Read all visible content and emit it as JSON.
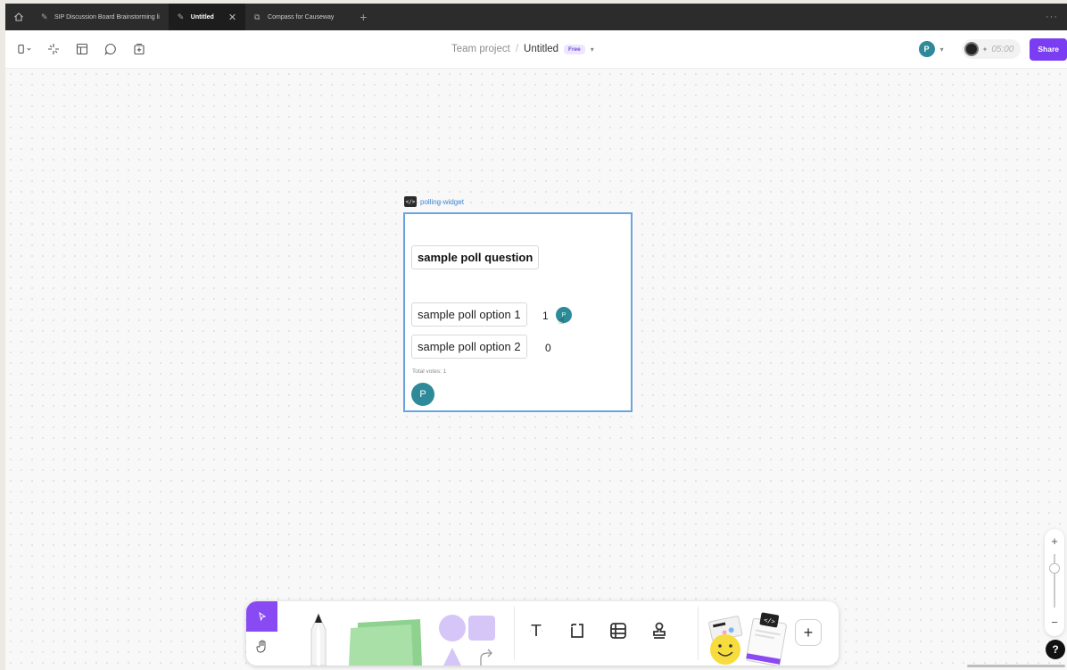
{
  "tabs": [
    {
      "label": "SIP Discussion Board Brainstorming li",
      "active": false
    },
    {
      "label": "Untitled",
      "active": true
    },
    {
      "label": "Compass for Causeway",
      "active": false
    }
  ],
  "toolbar": {
    "breadcrumb_team": "Team project",
    "breadcrumb_sep": "/",
    "file_name": "Untitled",
    "plan_badge": "Free",
    "user_initial": "P",
    "timer": "05:00",
    "share_label": "Share"
  },
  "widget": {
    "name": "polling-widget",
    "code_badge": "</>",
    "question": "sample poll question",
    "options": [
      {
        "label": "sample poll option 1",
        "votes": "1"
      },
      {
        "label": "sample poll option 2",
        "votes": "0"
      }
    ],
    "total_votes": "Total votes: 1",
    "owner_initial": "P",
    "voter_initial": "P"
  },
  "dock": {
    "text_tool": "T",
    "plus_label": "+"
  },
  "zoom": {
    "plus": "+",
    "minus": "−"
  },
  "help_label": "?",
  "colors": {
    "accent": "#7b3df2",
    "avatar": "#2e8a99",
    "selection": "#6aa4e0"
  }
}
